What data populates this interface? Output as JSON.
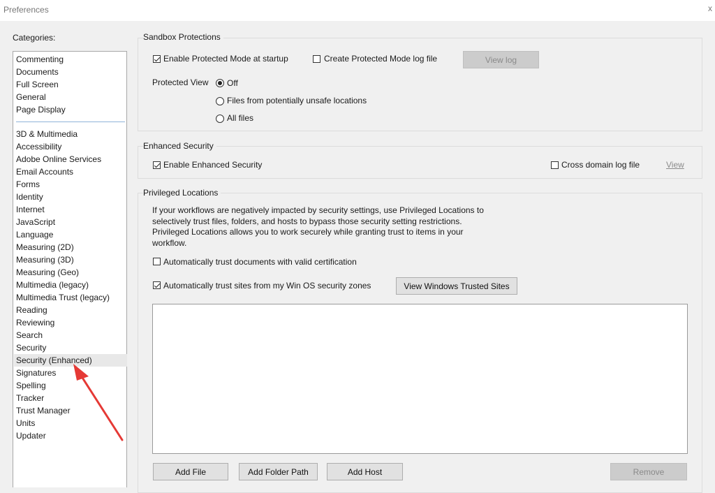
{
  "window": {
    "title": "Preferences",
    "close_glyph": "x"
  },
  "categories": {
    "label": "Categories:",
    "top_items": [
      "Commenting",
      "Documents",
      "Full Screen",
      "General",
      "Page Display"
    ],
    "items": [
      "3D & Multimedia",
      "Accessibility",
      "Adobe Online Services",
      "Email Accounts",
      "Forms",
      "Identity",
      "Internet",
      "JavaScript",
      "Language",
      "Measuring (2D)",
      "Measuring (3D)",
      "Measuring (Geo)",
      "Multimedia (legacy)",
      "Multimedia Trust (legacy)",
      "Reading",
      "Reviewing",
      "Search",
      "Security",
      "Security (Enhanced)",
      "Signatures",
      "Spelling",
      "Tracker",
      "Trust Manager",
      "Units",
      "Updater"
    ],
    "selected": "Security (Enhanced)"
  },
  "sandbox": {
    "title": "Sandbox Protections",
    "enable_protected_mode": {
      "label": "Enable Protected Mode at startup",
      "checked": true
    },
    "create_log": {
      "label": "Create Protected Mode log file",
      "checked": false
    },
    "view_log": "View log",
    "protected_view_label": "Protected View",
    "options": [
      {
        "label": "Off",
        "checked": true
      },
      {
        "label": "Files from potentially unsafe locations",
        "checked": false
      },
      {
        "label": "All files",
        "checked": false
      }
    ]
  },
  "enhanced": {
    "title": "Enhanced Security",
    "enable": {
      "label": "Enable Enhanced Security",
      "checked": true
    },
    "cross_domain": {
      "label": "Cross domain log file",
      "checked": false
    },
    "view_link": "View"
  },
  "privileged": {
    "title": "Privileged Locations",
    "description": "If your workflows are negatively impacted by security settings, use Privileged Locations to selectively trust files, folders, and hosts to bypass those security setting restrictions. Privileged Locations allows you to work securely while granting trust to items in your workflow.",
    "trust_certified": {
      "label": "Automatically trust documents with valid certification",
      "checked": false
    },
    "trust_sites": {
      "label": "Automatically trust sites from my Win OS security zones",
      "checked": true
    },
    "view_trusted_sites": "View Windows Trusted Sites",
    "add_file": "Add File",
    "add_folder": "Add Folder Path",
    "add_host": "Add Host",
    "remove": "Remove"
  },
  "annotation": {
    "arrow_color": "#e53935",
    "icon": "red-arrow-icon"
  }
}
